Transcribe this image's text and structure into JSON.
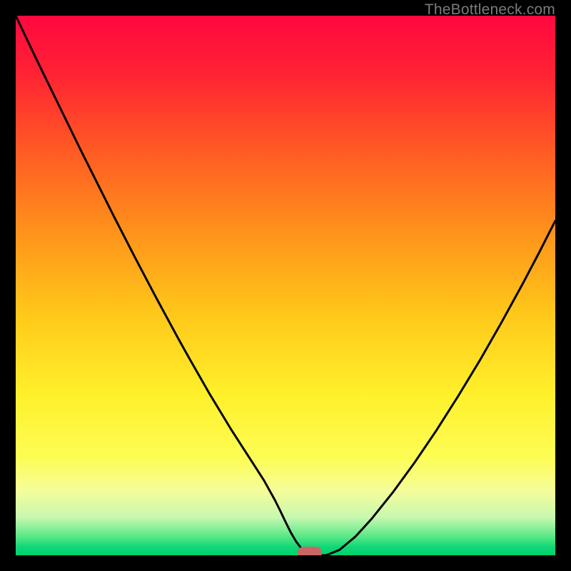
{
  "watermark": "TheBottleneck.com",
  "chart_data": {
    "type": "line",
    "title": "",
    "xlabel": "",
    "ylabel": "",
    "xlim": [
      0.0,
      1.0
    ],
    "ylim": [
      0.0,
      1.0
    ],
    "grid": false,
    "legend": false,
    "background": {
      "type": "vertical-gradient",
      "stops": [
        {
          "offset": 0.0,
          "color": "#ff0840"
        },
        {
          "offset": 0.1,
          "color": "#ff2034"
        },
        {
          "offset": 0.25,
          "color": "#ff5a24"
        },
        {
          "offset": 0.4,
          "color": "#ff921b"
        },
        {
          "offset": 0.55,
          "color": "#ffc71a"
        },
        {
          "offset": 0.7,
          "color": "#fff02a"
        },
        {
          "offset": 0.82,
          "color": "#fdfd55"
        },
        {
          "offset": 0.88,
          "color": "#f5fd9a"
        },
        {
          "offset": 0.93,
          "color": "#c7f8b0"
        },
        {
          "offset": 0.965,
          "color": "#5ae886"
        },
        {
          "offset": 0.985,
          "color": "#0ed777"
        },
        {
          "offset": 1.0,
          "color": "#00d26d"
        }
      ]
    },
    "series": [
      {
        "name": "bottleneck-curve",
        "color": "#000000",
        "width": 3,
        "x": [
          0.0,
          0.02,
          0.04,
          0.06,
          0.08,
          0.1,
          0.12,
          0.14,
          0.16,
          0.18,
          0.2,
          0.22,
          0.24,
          0.26,
          0.28,
          0.3,
          0.32,
          0.34,
          0.36,
          0.38,
          0.4,
          0.42,
          0.44,
          0.46,
          0.48,
          0.49,
          0.5,
          0.51,
          0.52,
          0.53,
          0.54,
          0.555,
          0.575,
          0.6,
          0.63,
          0.66,
          0.7,
          0.74,
          0.78,
          0.82,
          0.86,
          0.9,
          0.94,
          0.97,
          1.0
        ],
        "y": [
          1.0,
          0.958,
          0.916,
          0.875,
          0.834,
          0.793,
          0.752,
          0.712,
          0.672,
          0.632,
          0.593,
          0.554,
          0.516,
          0.478,
          0.441,
          0.404,
          0.368,
          0.333,
          0.298,
          0.265,
          0.232,
          0.201,
          0.17,
          0.139,
          0.103,
          0.083,
          0.062,
          0.042,
          0.025,
          0.012,
          0.003,
          0.0,
          0.0,
          0.01,
          0.035,
          0.068,
          0.118,
          0.173,
          0.232,
          0.295,
          0.361,
          0.431,
          0.504,
          0.561,
          0.62
        ]
      }
    ],
    "marker": {
      "shape": "rounded-rect",
      "color": "#cc6666",
      "cx": 0.545,
      "cy": 0.005,
      "w": 0.045,
      "h": 0.022,
      "rx": 0.011
    }
  }
}
